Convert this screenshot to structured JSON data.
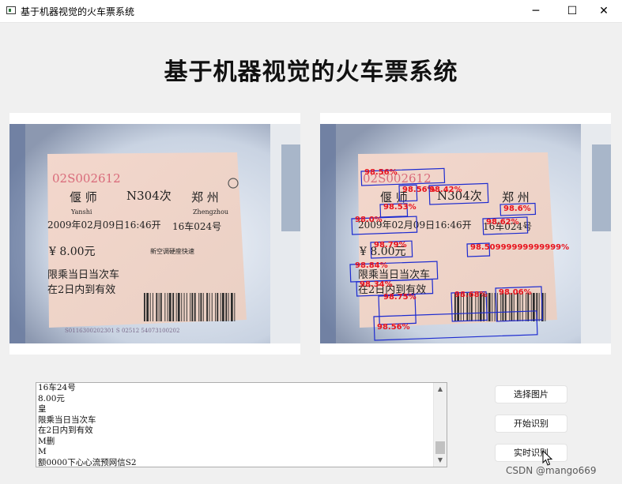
{
  "window": {
    "title": "基于机器视觉的火车票系统",
    "controls": {
      "minimize": "─",
      "maximize": "☐",
      "close": "✕"
    }
  },
  "heading": "基于机器视觉的火车票系统",
  "ticket": {
    "code": "02S002612",
    "from": "偃  师",
    "train": "N304次",
    "to": "郑  州",
    "from_pinyin": "Yanshi",
    "to_pinyin": "Zhengzhou",
    "datetime": "2009年02月09日16:46开",
    "seat": "16车024号",
    "price": "¥ 8.00元",
    "seat_type": "新空调硬座快速",
    "notice1": "限乘当日当次车",
    "notice2": "在2日内到有效",
    "serial": "S0116300202301 S 02512 54073100202"
  },
  "detections": [
    {
      "label": "98.56%"
    },
    {
      "label": "98.56%"
    },
    {
      "label": "98.42%"
    },
    {
      "label": "98.53%"
    },
    {
      "label": "98.6%"
    },
    {
      "label": "98.0%"
    },
    {
      "label": "98.62%"
    },
    {
      "label": "98.79%"
    },
    {
      "label": "98.50999999999999%"
    },
    {
      "label": "98.84%"
    },
    {
      "label": "98.34%"
    },
    {
      "label": "98.75%"
    },
    {
      "label": "98.68%"
    },
    {
      "label": "98.06%"
    },
    {
      "label": "98.56%"
    }
  ],
  "output_lines": [
    "16车24号",
    "8.00元",
    "皇",
    "限乘当日当次车",
    "在2日内到有效",
    "M删",
    "M",
    "额0000下心心流预网信S2"
  ],
  "scrollbar": {
    "up_arrow": "▲",
    "down_arrow": "▼"
  },
  "buttons": {
    "select_image": "选择图片",
    "start_recognition": "开始识别",
    "realtime_recognition": "实时识别"
  },
  "watermark": "CSDN @mango669",
  "colors": {
    "box": "#1d2bd0",
    "label": "#e8141e",
    "ticket": "#efcfc2"
  }
}
